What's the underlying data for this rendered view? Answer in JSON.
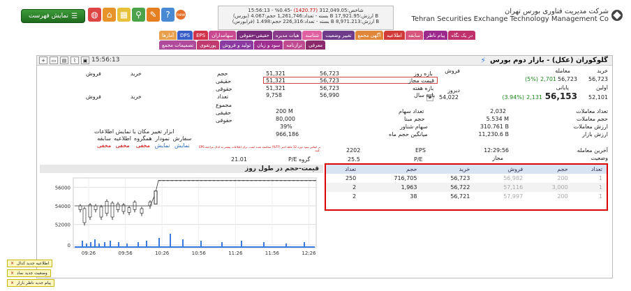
{
  "toolbar": {
    "menu_label": "نمایش فهرست",
    "menu_icon": "hamburger-icon",
    "badge": "new"
  },
  "ticker": {
    "line1_a": "15:56:13 - %0.45-",
    "line1_red": "(1420.77)",
    "line1_b": "312,049.05:شاخص",
    "line2": "(بورس) بسته - تعداد:1,261,746 حجم:4.067 B ارزش:17,921.95 B",
    "line3": "(فرابورس) بسته - تعداد:226,316 حجم:1.498 B ارزش:8,971.213 B"
  },
  "brand": {
    "title_fa": "شرکت مدیریت فناوری بورس تهران",
    "title_en": "Tehran Securities Exchange Technology Management Co"
  },
  "tabs": [
    {
      "label": "در یک نگاه",
      "color": "#c0306a"
    },
    {
      "label": "پیام ناظر",
      "color": "#9c2a8c"
    },
    {
      "label": "سابقه",
      "color": "#d8567e"
    },
    {
      "label": "اطلاعیه",
      "color": "#d23a3a"
    },
    {
      "label": "آگهی مجمع",
      "color": "#e0873a"
    },
    {
      "label": "تغییر وضعیت",
      "color": "#6e3a8a"
    },
    {
      "label": "شناسه",
      "color": "#e060a0"
    },
    {
      "label": "هیات مدیره",
      "color": "#8a3a8a"
    },
    {
      "label": "حقیقی-حقوقی",
      "color": "#7a2a7a"
    },
    {
      "label": "سهامداران",
      "color": "#c94a90"
    },
    {
      "label": "EPS",
      "color": "#d2324a"
    },
    {
      "label": "DPS",
      "color": "#3a5ec9"
    },
    {
      "label": "آمارها",
      "color": "#e8a04a"
    },
    {
      "label": "معرفی",
      "color": "#8a2a6a"
    },
    {
      "label": "ترازنامه",
      "color": "#c04a90"
    },
    {
      "label": "سود و زیان",
      "color": "#a03090"
    },
    {
      "label": "تولید و فروش",
      "color": "#8a3aa0"
    },
    {
      "label": "پورتفوی",
      "color": "#c03a70"
    },
    {
      "label": "تصمیمات مجمع",
      "color": "#b04a9a"
    }
  ],
  "window": {
    "time": "15:56:13",
    "title": "گلوکوران (عکل) - بازار دوم بورس"
  },
  "price": {
    "trade_lbl": "معامله",
    "trade_pct": "(5%)",
    "trade_chg": "2,701",
    "trade_val": "56,723",
    "first_lbl": "اولین",
    "first_val": "56,723",
    "buy_lbl": "خرید",
    "sell_lbl": "فروش",
    "last_lbl": "پایانی",
    "last_pct": "(3.94%)",
    "last_chg": "2,131",
    "last_val": "56,153",
    "last_right": "52,101",
    "yesterday_lbl": "دیروز",
    "yesterday_val": "54,022"
  },
  "range": {
    "day_lbl": "بازه روز",
    "day_lo": "51,321",
    "day_hi": "56,723",
    "allowed_lbl": "قیمت مجاز",
    "allowed_lo": "51,321",
    "allowed_hi": "56,723",
    "week_lbl": "بازه هفته",
    "week_lo": "51,321",
    "week_hi": "56,723",
    "year_lbl": "بازه سال",
    "year_lo": "9,758",
    "year_hi": "56,990"
  },
  "stats": {
    "count_lbl": "تعداد معاملات",
    "count_val": "2,032",
    "vol_lbl": "حجم معاملات",
    "vol_val": "5.534 M",
    "value_lbl": "ارزش معاملات",
    "value_val": "310.761 B",
    "mcap_lbl": "ارزش بازار",
    "mcap_val": "11,230.6 B",
    "last_trade_lbl": "آخرین معامله",
    "last_trade_val": "12:29:56",
    "status_lbl": "وضعیت",
    "status_val": "مجاز"
  },
  "shares": {
    "shares_lbl": "تعداد سهام",
    "shares_val": "200 M",
    "base_lbl": "حجم مبنا",
    "base_val": "80,000",
    "float_lbl": "سهام شناور",
    "float_val": "39%",
    "avgvol_lbl": "میانگین حجم ماه",
    "avgvol_val": "966,186",
    "eps_lbl": "EPS",
    "eps_val": "2202",
    "pe_lbl": "P/E",
    "pe_val": "25.5",
    "group_pe_lbl": "P/E گروه",
    "group_pe_val": "21.01",
    "note": "EPS بر اساس سود دوره 12 ماهه اخیر (77%) محاسبه شده است. برای اطلاعات بیشتر به کدال مراجعه کنید."
  },
  "client": {
    "vol_lbl": "حجم",
    "buy_lbl": "خرید",
    "sell_lbl": "فروش",
    "real": "حقیقی",
    "legal": "حقوقی",
    "count": "تعداد",
    "sum": "مجموع"
  },
  "tools": {
    "title": "ابزار تغییر مکان یا نمایش اطلاعات",
    "cols": [
      {
        "h": "سفارش",
        "v": "نمایش"
      },
      {
        "h": "نمودار",
        "v": "نمایش"
      },
      {
        "h": "همگروه",
        "v": "مخفی"
      },
      {
        "h": "اطلاعیه",
        "v": "مخفی"
      },
      {
        "h": "سابقه",
        "v": "مخفی"
      }
    ]
  },
  "orderbook": {
    "headers": [
      "تعداد",
      "حجم",
      "خرید",
      "فروش",
      "حجم",
      "تعداد"
    ],
    "rows": [
      {
        "buy_n": "250",
        "buy_vol": "716,705",
        "buy_p": "56,723",
        "sell_p": "56,982",
        "sell_vol": "200",
        "sell_n": "1"
      },
      {
        "buy_n": "2",
        "buy_vol": "1,963",
        "buy_p": "56,722",
        "sell_p": "57,116",
        "sell_vol": "3,000",
        "sell_n": "1"
      },
      {
        "buy_n": "2",
        "buy_vol": "38",
        "buy_p": "56,721",
        "sell_p": "57,997",
        "sell_vol": "200",
        "sell_n": "1"
      }
    ]
  },
  "chart_data": {
    "type": "line",
    "title": "قیمت-حجم در طول روز",
    "x_ticks": [
      "09:26",
      "09:56",
      "10:26",
      "10:56",
      "11:26",
      "11:56",
      "12:26"
    ],
    "y_ticks": [
      "56000",
      "54000",
      "52000",
      "0"
    ],
    "ylim": [
      51000,
      57000
    ],
    "legend": "none"
  },
  "notifications": [
    "اطلاعیه جدید کدال",
    "وضعیت جدید نماد",
    "پیام جدید ناظر بازار"
  ]
}
